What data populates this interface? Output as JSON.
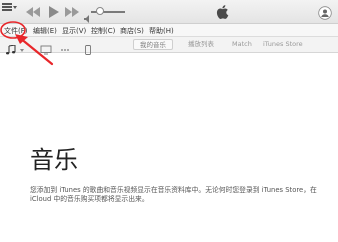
{
  "toolbar": {
    "icons": [
      "menu-icon",
      "rewind-icon",
      "play-icon",
      "fast-forward-icon",
      "volume-icon",
      "apple-icon",
      "user-icon"
    ],
    "volume_level": 0.25
  },
  "menubar": {
    "items": [
      {
        "label": "文件(F)"
      },
      {
        "label": "编辑(E)"
      },
      {
        "label": "显示(V)"
      },
      {
        "label": "控制(C)"
      },
      {
        "label": "商店(S)"
      },
      {
        "label": "帮助(H)"
      }
    ]
  },
  "mediabar": {
    "tabs": [
      {
        "label": "我的音乐"
      },
      {
        "label": "播放列表"
      },
      {
        "label": "Match"
      },
      {
        "label": "iTunes Store"
      }
    ]
  },
  "main": {
    "title": "音乐",
    "description": "您添加到 iTunes 的歌曲和音乐视频显示在音乐资料库中。无论何时您登录到 iTunes Store，在 iCloud 中的音乐购买项都将显示出来。"
  },
  "colors": {
    "annotation": "#e8262a"
  }
}
